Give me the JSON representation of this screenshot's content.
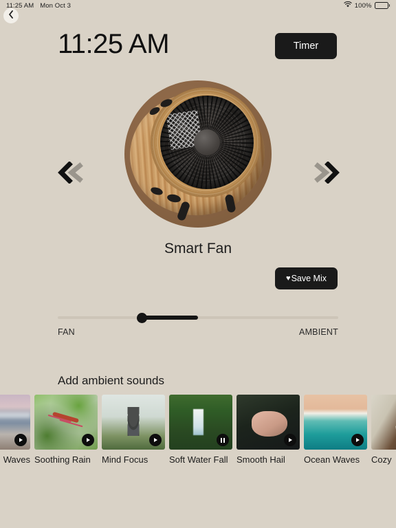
{
  "statusbar": {
    "time": "11:25 AM",
    "date": "Mon Oct 3",
    "wifi_icon": "wifi-icon",
    "battery_percent": "100%",
    "battery_icon": "battery-full-icon"
  },
  "nav": {
    "back_icon": "chevron-left-icon",
    "prev_icon": "double-chevron-left-icon",
    "next_icon": "double-chevron-right-icon"
  },
  "header": {
    "clock": "11:25 AM",
    "timer_label": "Timer"
  },
  "device": {
    "name": "Smart Fan",
    "artwork_name": "smart-fan-image"
  },
  "save_mix": {
    "icon": "heart-icon",
    "heart_glyph": "♥",
    "label": "Save Mix"
  },
  "mix_slider": {
    "left_label": "FAN",
    "right_label": "AMBIENT",
    "value_percent": 30,
    "fill_end_percent": 50,
    "accent_color": "#151515",
    "track_color": "#cdc5b8"
  },
  "ambient": {
    "section_title": "Add ambient sounds",
    "cards": [
      {
        "label": "Waves",
        "thumb": "th-waves",
        "state": "play",
        "icon": "play-icon",
        "partial": true
      },
      {
        "label": "Soothing Rain",
        "thumb": "th-rain",
        "state": "play",
        "icon": "play-icon",
        "partial": false
      },
      {
        "label": "Mind Focus",
        "thumb": "th-stones",
        "state": "play",
        "icon": "play-icon",
        "partial": false
      },
      {
        "label": "Soft Water Fall",
        "thumb": "th-falls",
        "state": "pause",
        "icon": "pause-icon",
        "partial": false
      },
      {
        "label": "Smooth Hail",
        "thumb": "th-hail",
        "state": "play",
        "icon": "play-icon",
        "partial": false
      },
      {
        "label": "Ocean Waves",
        "thumb": "th-ocean",
        "state": "play",
        "icon": "play-icon",
        "partial": false
      },
      {
        "label": "Cozy",
        "thumb": "th-cozy",
        "state": "play",
        "icon": "play-icon",
        "partial": true
      }
    ]
  },
  "theme": {
    "background": "#d9d2c6",
    "text": "#1c1c1c",
    "button_bg": "#1a1a1a",
    "button_text": "#ffffff"
  }
}
